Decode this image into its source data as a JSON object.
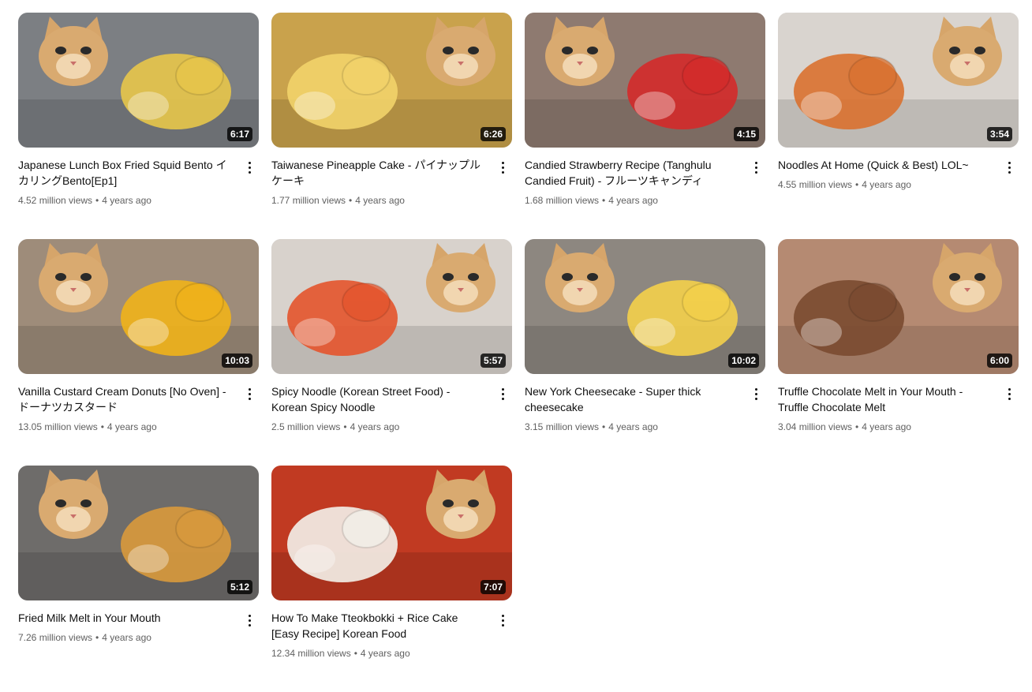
{
  "videos": [
    {
      "title": "Japanese Lunch Box Fried Squid Bento イカリングBento[Ep1]",
      "views": "4.52 million views",
      "age": "4 years ago",
      "duration": "6:17",
      "bg": "#7c7f83",
      "accent": "#e8c64a"
    },
    {
      "title": "Taiwanese Pineapple Cake - パイナップルケーキ",
      "views": "1.77 million views",
      "age": "4 years ago",
      "duration": "6:26",
      "bg": "#c9a24c",
      "accent": "#f2d36a"
    },
    {
      "title": "Candied Strawberry Recipe (Tanghulu Candied Fruit) - フルーツキャンディ",
      "views": "1.68 million views",
      "age": "4 years ago",
      "duration": "4:15",
      "bg": "#8e7a70",
      "accent": "#d42a2a"
    },
    {
      "title": "Noodles At Home (Quick & Best) LOL~",
      "views": "4.55 million views",
      "age": "4 years ago",
      "duration": "3:54",
      "bg": "#d9d4cf",
      "accent": "#d9712f"
    },
    {
      "title": "Vanilla Custard Cream Donuts [No Oven] - ドーナツカスタード",
      "views": "13.05 million views",
      "age": "4 years ago",
      "duration": "10:03",
      "bg": "#9e8c7a",
      "accent": "#f0b21a"
    },
    {
      "title": "Spicy Noodle (Korean Street Food) - Korean Spicy Noodle",
      "views": "2.5 million views",
      "age": "4 years ago",
      "duration": "5:57",
      "bg": "#d8d2cc",
      "accent": "#e4542c"
    },
    {
      "title": "New York Cheesecake - Super thick cheesecake",
      "views": "3.15 million views",
      "age": "4 years ago",
      "duration": "10:02",
      "bg": "#8d8780",
      "accent": "#f4d04a"
    },
    {
      "title": "Truffle Chocolate Melt in Your Mouth - Truffle Chocolate Melt",
      "views": "3.04 million views",
      "age": "4 years ago",
      "duration": "6:00",
      "bg": "#b58a72",
      "accent": "#7a4a30"
    },
    {
      "title": "Fried Milk Melt in Your Mouth",
      "views": "7.26 million views",
      "age": "4 years ago",
      "duration": "5:12",
      "bg": "#6e6c6a",
      "accent": "#d99a3c"
    },
    {
      "title": "How To Make Tteokbokki + Rice Cake [Easy Recipe] Korean Food",
      "views": "12.34 million views",
      "age": "4 years ago",
      "duration": "7:07",
      "bg": "#c13a22",
      "accent": "#f3f1ea"
    }
  ]
}
